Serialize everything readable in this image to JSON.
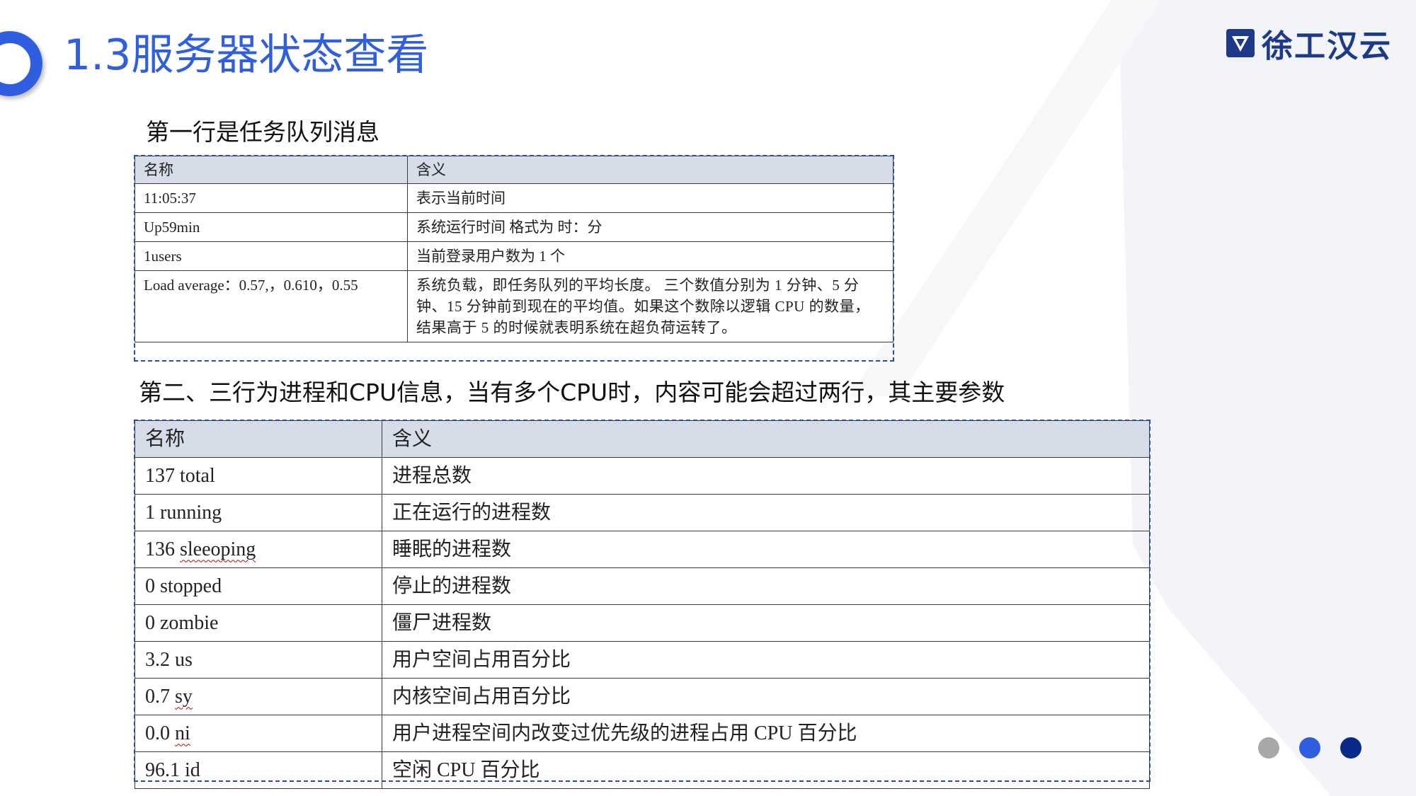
{
  "header": {
    "title": "1.3服务器状态查看",
    "logo_text": "徐工汉云"
  },
  "section1": {
    "heading": "第一行是任务队列消息",
    "columns": [
      "名称",
      "含义"
    ],
    "rows": [
      {
        "name": "11:05:37",
        "meaning": "表示当前时间"
      },
      {
        "name": "Up59min",
        "meaning": "系统运行时间  格式为 时：分"
      },
      {
        "name": "1users",
        "meaning": "当前登录用户数为 1 个"
      },
      {
        "name": "Load average：0.57,，0.610，0.55",
        "meaning": "系统负载，即任务队列的平均长度。 三个数值分别为 1 分钟、5 分钟、15 分钟前到现在的平均值。如果这个数除以逻辑 CPU 的数量，结果高于 5 的时候就表明系统在超负荷运转了。"
      }
    ]
  },
  "section2": {
    "heading": "第二、三行为进程和CPU信息，当有多个CPU时，内容可能会超过两行，其主要参数",
    "columns": [
      "名称",
      "含义"
    ],
    "rows": [
      {
        "num": "137",
        "word": "total",
        "meaning": "进程总数"
      },
      {
        "num": "1",
        "word": "running",
        "meaning": "正在运行的进程数"
      },
      {
        "num": "136",
        "word": "sleeoping",
        "meaning": "睡眠的进程数"
      },
      {
        "num": "0",
        "word": "stopped",
        "meaning": "停止的进程数"
      },
      {
        "num": "0",
        "word": "zombie",
        "meaning": "僵尸进程数"
      },
      {
        "num": "3.2",
        "word": "us",
        "meaning": "用户空间占用百分比"
      },
      {
        "num": "0.7",
        "word": "sy",
        "meaning": "内核空间占用百分比"
      },
      {
        "num": "0.0",
        "word": "ni",
        "meaning": "用户进程空间内改变过优先级的进程占用 CPU 百分比"
      },
      {
        "num": "96.1",
        "word": "id",
        "meaning": "空闲 CPU 百分比"
      }
    ]
  },
  "colors": {
    "accent": "#2f5fe0",
    "logo": "#1d3a8a",
    "header_row": "#d6dde8",
    "dot_gray": "#a8a8a8",
    "dot_blue": "#2f5fe0",
    "dot_navy": "#0a2a8a"
  }
}
